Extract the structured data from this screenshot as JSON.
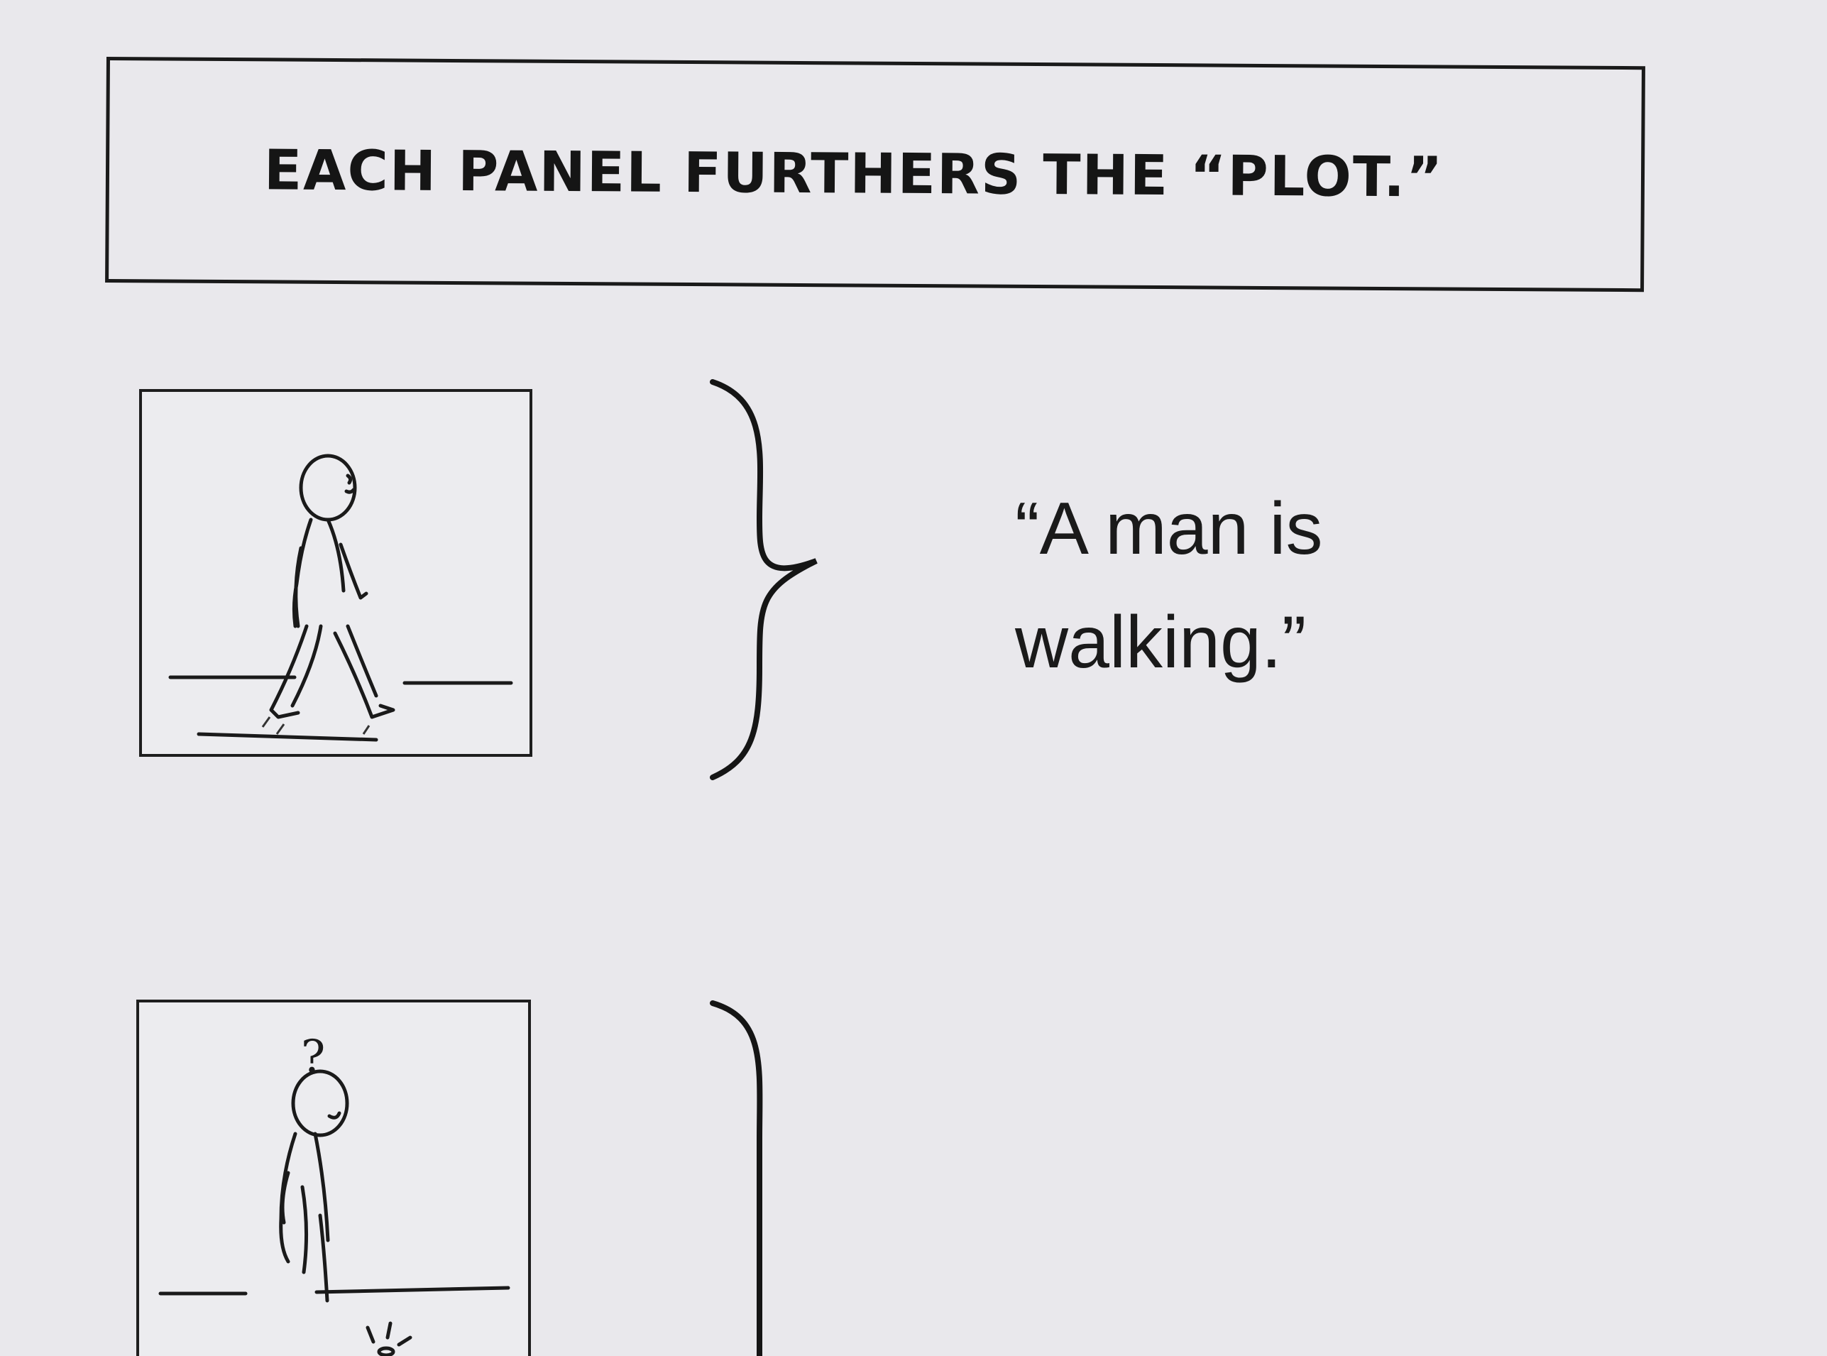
{
  "header": {
    "caption": "EACH PANEL FURTHERS THE “PLOT.”"
  },
  "panels": [
    {
      "narration_line1": "“A man is",
      "narration_line2": "walking.”"
    },
    {
      "thought_mark": "?"
    }
  ],
  "colors": {
    "page": "#e9e8ec",
    "ink": "#1a1a1a"
  }
}
